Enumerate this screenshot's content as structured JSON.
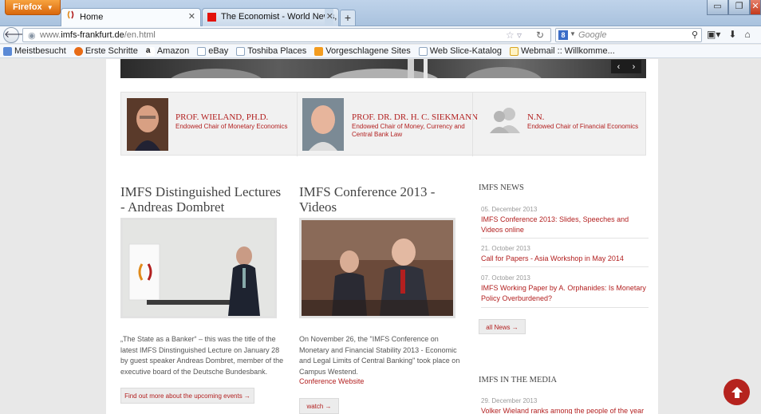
{
  "browser": {
    "menu_button": "Firefox",
    "tabs": [
      {
        "title": "Home",
        "active": true
      },
      {
        "title": "The Economist - World News, Politics...",
        "active": false
      }
    ],
    "url_prefix": "www.",
    "url_domain": "imfs-frankfurt.de",
    "url_path": "/en.html",
    "search_placeholder": "Google",
    "bookmarks": [
      {
        "label": "Meistbesucht",
        "icon": "bookmark-folder-icon"
      },
      {
        "label": "Erste Schritte",
        "icon": "firefox-icon"
      },
      {
        "label": "Amazon",
        "icon": "amazon-icon"
      },
      {
        "label": "eBay",
        "icon": "page-icon"
      },
      {
        "label": "Toshiba Places",
        "icon": "page-icon"
      },
      {
        "label": "Vorgeschlagene Sites",
        "icon": "suggested-sites-icon"
      },
      {
        "label": "Web Slice-Katalog",
        "icon": "page-icon"
      },
      {
        "label": "Webmail :: Willkomme...",
        "icon": "mail-icon"
      }
    ]
  },
  "professors": [
    {
      "name": "PROF. WIELAND, PH.D.",
      "role": "Endowed Chair of Monetary Economics"
    },
    {
      "name": "PROF. DR. DR. H. C. SIEKMANN",
      "role": "Endowed Chair of Money, Currency and Central Bank Law"
    },
    {
      "name": "N.N.",
      "role": "Endowed Chair of Financial Economics"
    }
  ],
  "lectures": {
    "title": "IMFS Distinguished Lectures - Andreas Dombret",
    "text": "„The State as a Banker“ – this was the title of the latest IMFS Dinstinguished Lecture on January 28 by guest speaker Andreas Dombret, member of the executive board of the Deutsche Bundesbank.",
    "button": "Find out more about the upcoming events →"
  },
  "conference": {
    "title": "IMFS Conference 2013 - Videos",
    "text": "On November 26, the \"IMFS Conference on Monetary and Financial Stability 2013 - Economic and Legal Limits of Central Banking\" took place on Campus Westend.",
    "link": "Conference Website",
    "button": "watch →"
  },
  "news": {
    "heading": "IMFS NEWS",
    "items": [
      {
        "date": "05. December 2013",
        "text": "IMFS Conference 2013: Slides, Speeches and Videos online"
      },
      {
        "date": "21. October 2013",
        "text": "Call for Papers - Asia Workshop in May 2014"
      },
      {
        "date": "07. October 2013",
        "text": "IMFS Working Paper by A. Orphanides: Is Monetary Policy Overburdened?"
      }
    ],
    "all_button": "all News →"
  },
  "media": {
    "heading": "IMFS IN THE MEDIA",
    "items": [
      {
        "date": "29. December 2013",
        "text": "Volker Wieland ranks among the people of the year"
      }
    ]
  }
}
